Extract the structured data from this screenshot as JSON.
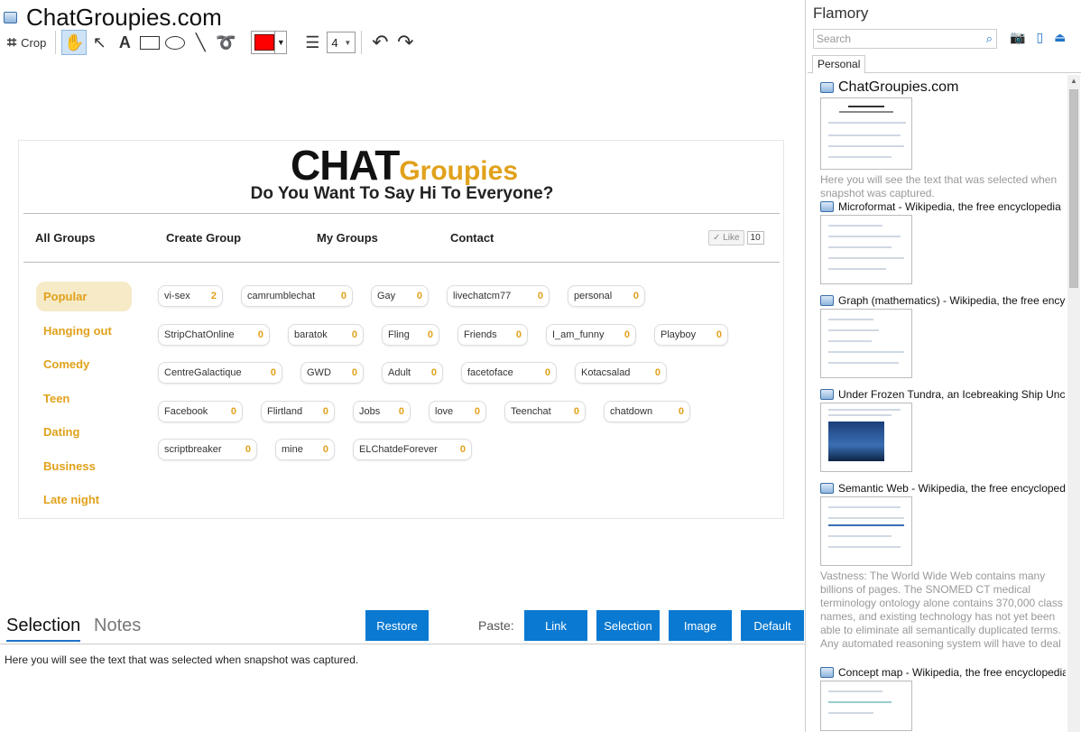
{
  "window": {
    "title": "ChatGroupies.com"
  },
  "toolbar": {
    "crop_label": "Crop",
    "crop_icon": "crop-icon",
    "text_tool": "A",
    "stroke_width": "4",
    "color": "#ff0000"
  },
  "snapshot": {
    "brand_dark": "CHAT",
    "brand_accent": "Groupies",
    "tagline": "Do You Want To Say Hi To Everyone?",
    "nav": [
      "All Groups",
      "Create Group",
      "My Groups",
      "Contact"
    ],
    "like_label": "Like",
    "like_count": "10",
    "accent_color": "#e1a11b",
    "categories": [
      "Popular",
      "Hanging out",
      "Comedy",
      "Teen",
      "Dating",
      "Business",
      "Late night"
    ],
    "group_rows": [
      [
        {
          "name": "vi-sex",
          "count": "2"
        },
        {
          "name": "camrumblechat",
          "count": "0"
        },
        {
          "name": "Gay",
          "count": "0"
        },
        {
          "name": "livechatcm77",
          "count": "0"
        },
        {
          "name": "personal",
          "count": "0"
        }
      ],
      [
        {
          "name": "StripChatOnline",
          "count": "0"
        },
        {
          "name": "baratok",
          "count": "0"
        },
        {
          "name": "Fling",
          "count": "0"
        },
        {
          "name": "Friends",
          "count": "0"
        },
        {
          "name": "I_am_funny",
          "count": "0"
        },
        {
          "name": "Playboy",
          "count": "0"
        }
      ],
      [
        {
          "name": "CentreGalactique",
          "count": "0"
        },
        {
          "name": "GWD",
          "count": "0"
        },
        {
          "name": "Adult",
          "count": "0"
        },
        {
          "name": "facetoface",
          "count": "0"
        },
        {
          "name": "Kotacsalad",
          "count": "0"
        }
      ],
      [
        {
          "name": "Facebook",
          "count": "0"
        },
        {
          "name": "Flirtland",
          "count": "0"
        },
        {
          "name": "Jobs",
          "count": "0"
        },
        {
          "name": "love",
          "count": "0"
        },
        {
          "name": "Teenchat",
          "count": "0"
        },
        {
          "name": "chatdown",
          "count": "0"
        }
      ],
      [
        {
          "name": "scriptbreaker",
          "count": "0"
        },
        {
          "name": "mine",
          "count": "0"
        },
        {
          "name": "ELChatdeForever",
          "count": "0"
        }
      ]
    ]
  },
  "bottom": {
    "tab_selection": "Selection",
    "tab_notes": "Notes",
    "restore": "Restore",
    "paste_label": "Paste:",
    "link": "Link",
    "selection": "Selection",
    "image": "Image",
    "default": "Default",
    "selected_text": "Here you will see the text that was selected when snapshot was captured."
  },
  "sidebar": {
    "app_name": "Flamory",
    "search_placeholder": "Search",
    "tab": "Personal",
    "entries": [
      {
        "title": "ChatGroupies.com",
        "desc": "Here you will see the text that was selected when snapshot was captured."
      },
      {
        "title": "Microformat - Wikipedia, the free encyclopedia",
        "desc": ""
      },
      {
        "title": "Graph (mathematics) - Wikipedia, the free encyc",
        "desc": ""
      },
      {
        "title": "Under Frozen Tundra, an Icebreaking Ship Unco",
        "desc": ""
      },
      {
        "title": "Semantic Web - Wikipedia, the free encycloped",
        "desc": "Vastness: The World Wide Web contains many billions of pages. The SNOMED CT medical terminology ontology alone contains 370,000 class names, and existing technology has not yet been able to eliminate all semantically duplicated terms. Any automated reasoning system will have to deal with truly huge inputs."
      },
      {
        "title": "Concept map - Wikipedia, the free encyclopedia",
        "desc": ""
      }
    ]
  }
}
